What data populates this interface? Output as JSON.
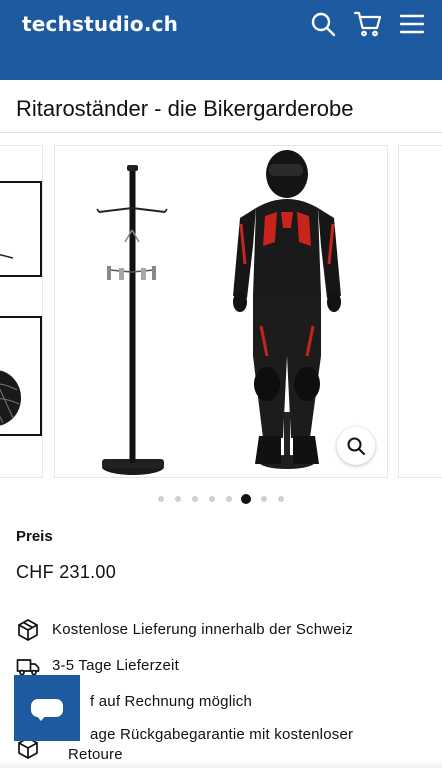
{
  "header": {
    "brand": "techstudio.ch",
    "icons": [
      "search-icon",
      "cart-icon",
      "menu-icon"
    ],
    "background_color": "#1e5aa0"
  },
  "product": {
    "title": "Ritaroständer - die Bikergarderobe",
    "price_label": "Preis",
    "price": "CHF 231.00"
  },
  "gallery": {
    "slide_count": 8,
    "active_slide_index": 5
  },
  "features": [
    {
      "icon": "package-icon",
      "text": "Kostenlose Lieferung innerhalb der Schweiz"
    },
    {
      "icon": "truck-icon",
      "text": "3-5 Tage Lieferzeit"
    },
    {
      "icon": "invoice-icon",
      "text": "f auf Rechnung möglich"
    },
    {
      "icon": "package-icon",
      "text": "age Rückgabegarantie mit kostenloser",
      "text_line2": "Retoure"
    }
  ],
  "chat": {
    "icon": "chat-icon"
  }
}
